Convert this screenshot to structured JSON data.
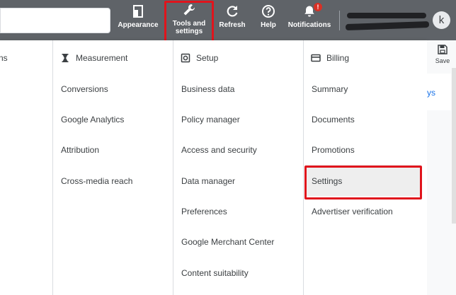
{
  "toolbar": {
    "appearance": "Appearance",
    "tools_line1": "Tools and",
    "tools_line2": "settings",
    "refresh": "Refresh",
    "help": "Help",
    "notifications": "Notifications",
    "notification_badge": "!",
    "avatar_initial": "k"
  },
  "menu": {
    "col0": {
      "header": "ns"
    },
    "measurement": {
      "header": "Measurement",
      "items": [
        "Conversions",
        "Google Analytics",
        "Attribution",
        "Cross-media reach"
      ]
    },
    "setup": {
      "header": "Setup",
      "items": [
        "Business data",
        "Policy manager",
        "Access and security",
        "Data manager",
        "Preferences",
        "Google Merchant Center",
        "Content suitability"
      ]
    },
    "billing": {
      "header": "Billing",
      "items": [
        "Summary",
        "Documents",
        "Promotions",
        "Settings",
        "Advertiser verification"
      ]
    }
  },
  "right": {
    "save": "Save",
    "link_fragment": "ys"
  },
  "colors": {
    "topbar": "#5f6368",
    "highlight": "#e0141c",
    "link": "#1a73e8"
  }
}
